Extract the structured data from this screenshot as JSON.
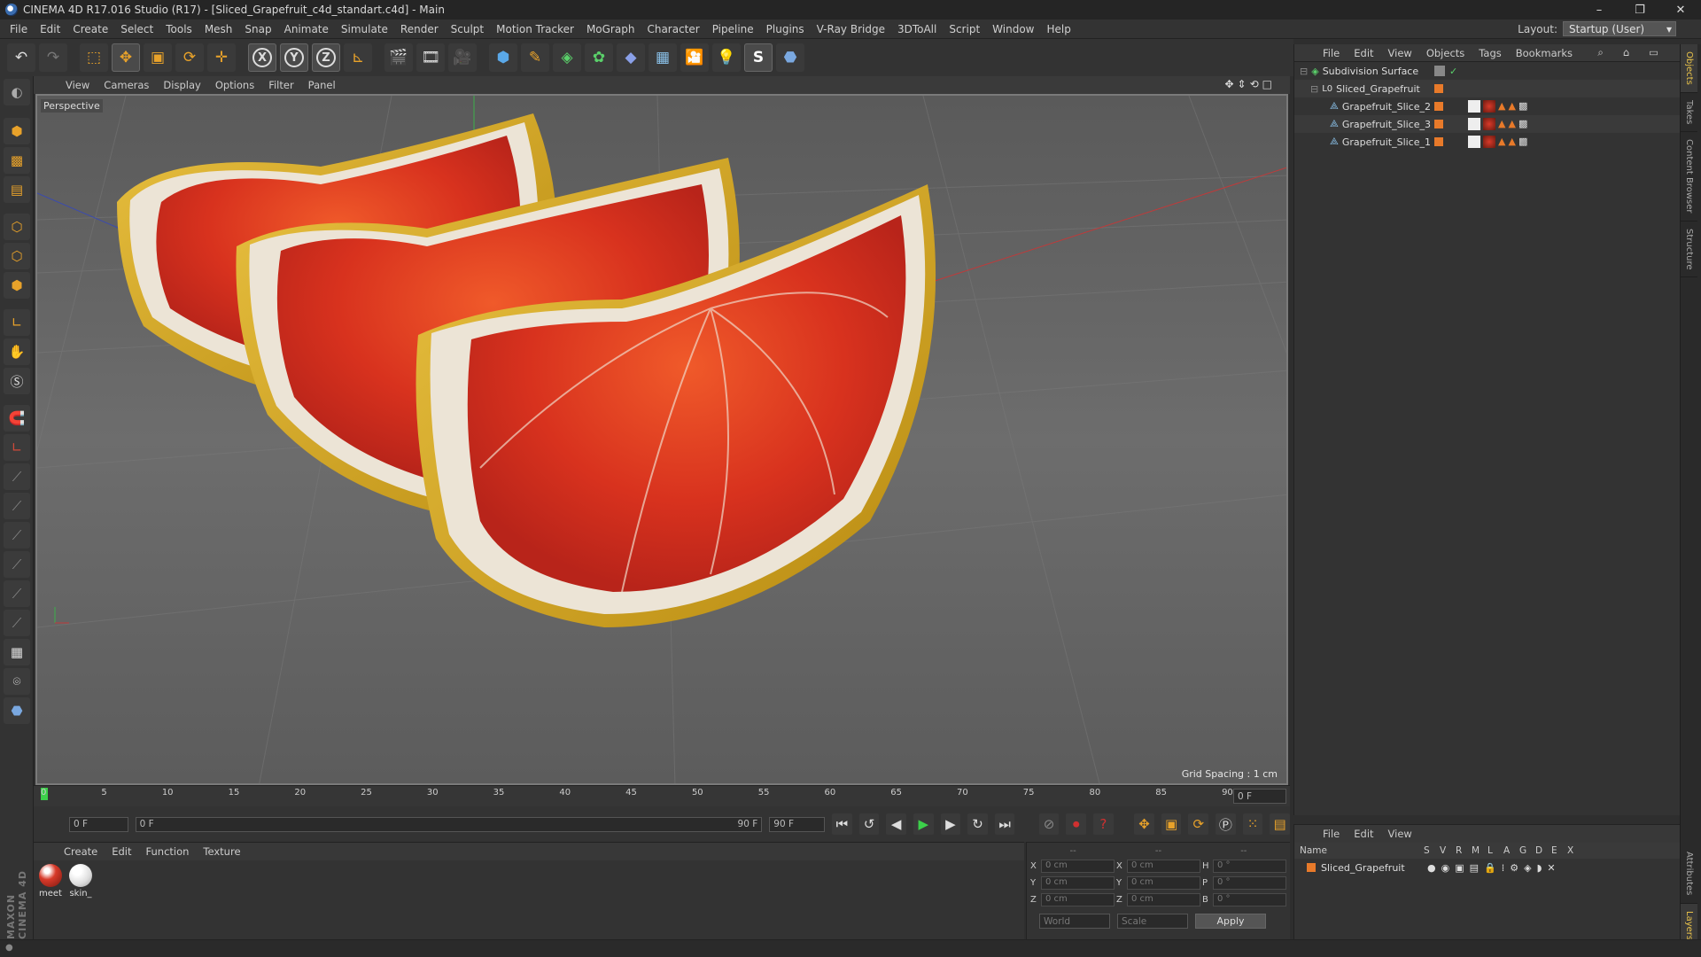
{
  "window": {
    "title": "CINEMA 4D R17.016 Studio (R17) - [Sliced_Grapefruit_c4d_standart.c4d] - Main",
    "controls": [
      "–",
      "❐",
      "✕"
    ]
  },
  "menubar": {
    "items": [
      "File",
      "Edit",
      "Create",
      "Select",
      "Tools",
      "Mesh",
      "Snap",
      "Animate",
      "Simulate",
      "Render",
      "Sculpt",
      "Motion Tracker",
      "MoGraph",
      "Character",
      "Pipeline",
      "Plugins",
      "V-Ray Bridge",
      "3DToAll",
      "Script",
      "Window",
      "Help"
    ],
    "layout_label": "Layout:",
    "layout_value": "Startup (User)"
  },
  "viewport": {
    "menu": [
      "View",
      "Cameras",
      "Display",
      "Options",
      "Filter",
      "Panel"
    ],
    "camera_label": "Perspective",
    "grid_spacing": "Grid Spacing : 1 cm"
  },
  "timeline": {
    "ticks": [
      "0",
      "5",
      "10",
      "15",
      "20",
      "25",
      "30",
      "35",
      "40",
      "45",
      "50",
      "55",
      "60",
      "65",
      "70",
      "75",
      "80",
      "85",
      "90"
    ],
    "current_frame": "0 F"
  },
  "transport": {
    "start_field": "0 F",
    "range_start": "0 F",
    "range_end": "90 F",
    "end_field": "90 F"
  },
  "materials": {
    "menu": [
      "Create",
      "Edit",
      "Function",
      "Texture"
    ],
    "items": [
      {
        "name": "meet"
      },
      {
        "name": "skin_"
      }
    ]
  },
  "coordinates": {
    "header": [
      "--",
      "--",
      "--"
    ],
    "rows": [
      {
        "a": "X",
        "av": "0 cm",
        "b": "X",
        "bv": "0 cm",
        "c": "H",
        "cv": "0 °"
      },
      {
        "a": "Y",
        "av": "0 cm",
        "b": "Y",
        "bv": "0 cm",
        "c": "P",
        "cv": "0 °"
      },
      {
        "a": "Z",
        "av": "0 cm",
        "b": "Z",
        "bv": "0 cm",
        "c": "B",
        "cv": "0 °"
      }
    ],
    "mode": "World",
    "scale": "Scale",
    "apply": "Apply"
  },
  "objects": {
    "menu": [
      "File",
      "Edit",
      "View",
      "Objects",
      "Tags",
      "Bookmarks"
    ],
    "rows": [
      {
        "name": "Subdivision Surface"
      },
      {
        "name": "Sliced_Grapefruit"
      },
      {
        "name": "Grapefruit_Slice_2"
      },
      {
        "name": "Grapefruit_Slice_3"
      },
      {
        "name": "Grapefruit_Slice_1"
      }
    ]
  },
  "layers": {
    "menu": [
      "File",
      "Edit",
      "View"
    ],
    "columns": [
      "Name",
      "S",
      "V",
      "R",
      "M",
      "L",
      "A",
      "G",
      "D",
      "E",
      "X"
    ],
    "rows": [
      {
        "name": "Sliced_Grapefruit"
      }
    ]
  },
  "right_tabs": [
    "Objects",
    "Takes",
    "Content Browser",
    "Structure",
    "Attributes",
    "Layers"
  ],
  "brand": "MAXON CINEMA 4D"
}
